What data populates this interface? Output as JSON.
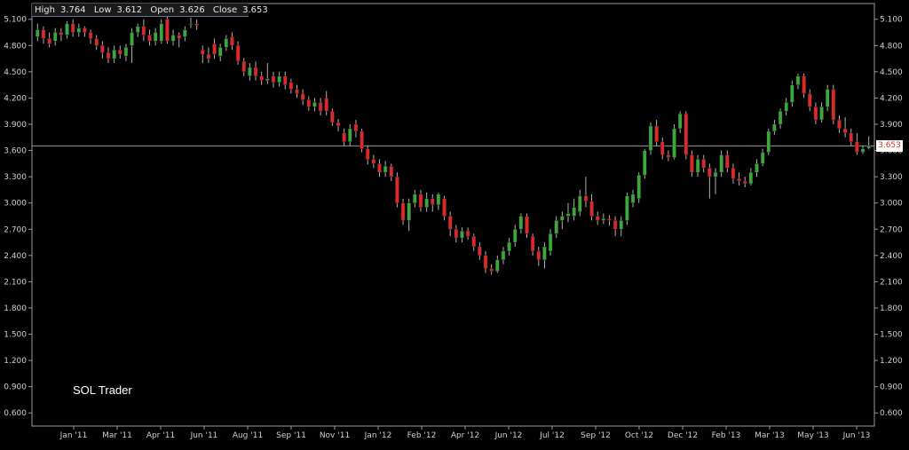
{
  "ohlc": {
    "high_label": "High",
    "high": "3.764",
    "low_label": "Low",
    "low": "3.612",
    "open_label": "Open",
    "open": "3.626",
    "close_label": "Close",
    "close": "3.653"
  },
  "watermark": "SOL Trader",
  "last_price_label": "3.653",
  "colors": {
    "up": "#3aa83a",
    "down": "#e02828",
    "wick": "#b0b0b0",
    "axis": "#9a9a9a",
    "background": "#000000",
    "last_line": "#9a9a9a"
  },
  "chart_data": {
    "type": "candlestick",
    "ylim": [
      0.45,
      5.28
    ],
    "y_ticks": [
      "5.100",
      "4.800",
      "4.500",
      "4.200",
      "3.900",
      "3.600",
      "3.300",
      "3.000",
      "2.700",
      "2.400",
      "2.100",
      "1.800",
      "1.500",
      "1.200",
      "0.900",
      "0.600"
    ],
    "x_ticks": [
      "Jan '11",
      "Mar '11",
      "Apr '11",
      "Jun '11",
      "Aug '11",
      "Sep '11",
      "Nov '11",
      "Jan '12",
      "Feb '12",
      "Apr '12",
      "Jun '12",
      "Jul '12",
      "Sep '12",
      "Oct '12",
      "Dec '12",
      "Feb '13",
      "Mar '13",
      "May '13",
      "Jun '13"
    ],
    "last_price": 3.653,
    "candles": [
      [
        4.9,
        4.98,
        5.05,
        4.85
      ],
      [
        4.98,
        4.88,
        5.02,
        4.82
      ],
      [
        4.88,
        4.82,
        4.95,
        4.78
      ],
      [
        4.85,
        4.95,
        5.0,
        4.8
      ],
      [
        4.95,
        4.92,
        5.0,
        4.85
      ],
      [
        4.92,
        5.05,
        5.08,
        4.88
      ],
      [
        5.05,
        4.95,
        5.1,
        4.9
      ],
      [
        4.95,
        5.0,
        5.05,
        4.9
      ],
      [
        5.0,
        4.95,
        5.02,
        4.9
      ],
      [
        4.95,
        4.88,
        4.98,
        4.82
      ],
      [
        4.88,
        4.8,
        4.92,
        4.75
      ],
      [
        4.8,
        4.72,
        4.85,
        4.65
      ],
      [
        4.72,
        4.65,
        4.78,
        4.6
      ],
      [
        4.65,
        4.75,
        4.8,
        4.6
      ],
      [
        4.75,
        4.7,
        4.8,
        4.65
      ],
      [
        4.68,
        4.78,
        4.82,
        4.62
      ],
      [
        4.8,
        4.95,
        5.0,
        4.6
      ],
      [
        4.95,
        5.02,
        5.05,
        4.9
      ],
      [
        5.02,
        4.92,
        5.1,
        4.85
      ],
      [
        4.92,
        4.85,
        4.98,
        4.8
      ],
      [
        4.85,
        4.95,
        5.0,
        4.8
      ],
      [
        4.85,
        5.05,
        5.1,
        4.82
      ],
      [
        5.1,
        4.85,
        5.15,
        4.82
      ],
      [
        4.85,
        4.92,
        4.98,
        4.8
      ],
      [
        4.92,
        4.88,
        4.95,
        4.78
      ],
      [
        4.9,
        4.98,
        5.02,
        4.85
      ],
      [
        5.05,
        5.05,
        5.12,
        5.0
      ],
      [
        5.05,
        5.03,
        5.1,
        4.98
      ],
      [
        4.75,
        4.7,
        4.8,
        4.6
      ],
      [
        4.7,
        4.65,
        4.78,
        4.6
      ],
      [
        4.82,
        4.7,
        4.88,
        4.65
      ],
      [
        4.68,
        4.78,
        4.82,
        4.62
      ],
      [
        4.78,
        4.88,
        4.92,
        4.74
      ],
      [
        4.9,
        4.8,
        4.95,
        4.75
      ],
      [
        4.8,
        4.62,
        4.85,
        4.58
      ],
      [
        4.62,
        4.5,
        4.66,
        4.45
      ],
      [
        4.45,
        4.55,
        4.6,
        4.4
      ],
      [
        4.55,
        4.45,
        4.62,
        4.4
      ],
      [
        4.45,
        4.4,
        4.5,
        4.35
      ],
      [
        4.4,
        4.42,
        4.6,
        4.36
      ],
      [
        4.45,
        4.38,
        4.5,
        4.32
      ],
      [
        4.38,
        4.45,
        4.5,
        4.33
      ],
      [
        4.45,
        4.35,
        4.5,
        4.3
      ],
      [
        4.38,
        4.3,
        4.42,
        4.25
      ],
      [
        4.3,
        4.25,
        4.35,
        4.2
      ],
      [
        4.25,
        4.18,
        4.3,
        4.12
      ],
      [
        4.18,
        4.1,
        4.22,
        4.05
      ],
      [
        4.1,
        4.15,
        4.2,
        4.05
      ],
      [
        4.15,
        4.05,
        4.2,
        4.0
      ],
      [
        4.2,
        4.05,
        4.28,
        4.0
      ],
      [
        4.05,
        3.92,
        4.08,
        3.88
      ],
      [
        3.92,
        3.88,
        3.96,
        3.82
      ],
      [
        3.8,
        3.7,
        3.85,
        3.65
      ],
      [
        3.7,
        3.85,
        3.9,
        3.65
      ],
      [
        3.9,
        3.82,
        3.95,
        3.75
      ],
      [
        3.82,
        3.62,
        3.85,
        3.58
      ],
      [
        3.62,
        3.5,
        3.66,
        3.44
      ],
      [
        3.5,
        3.45,
        3.55,
        3.4
      ],
      [
        3.45,
        3.35,
        3.5,
        3.3
      ],
      [
        3.35,
        3.42,
        3.48,
        3.3
      ],
      [
        3.42,
        3.3,
        3.45,
        3.25
      ],
      [
        3.3,
        3.0,
        3.35,
        2.95
      ],
      [
        3.0,
        2.8,
        3.05,
        2.75
      ],
      [
        2.8,
        3.0,
        3.05,
        2.68
      ],
      [
        3.0,
        3.1,
        3.15,
        2.95
      ],
      [
        3.1,
        2.95,
        3.15,
        2.9
      ],
      [
        2.95,
        3.05,
        3.12,
        2.9
      ],
      [
        3.05,
        2.98,
        3.1,
        2.9
      ],
      [
        2.98,
        3.1,
        3.12,
        2.92
      ],
      [
        3.05,
        2.85,
        3.08,
        2.8
      ],
      [
        2.85,
        2.7,
        2.9,
        2.62
      ],
      [
        2.7,
        2.6,
        2.75,
        2.55
      ],
      [
        2.6,
        2.68,
        2.72,
        2.55
      ],
      [
        2.68,
        2.62,
        2.72,
        2.58
      ],
      [
        2.62,
        2.5,
        2.65,
        2.45
      ],
      [
        2.5,
        2.4,
        2.55,
        2.35
      ],
      [
        2.4,
        2.25,
        2.45,
        2.2
      ],
      [
        2.25,
        2.22,
        2.3,
        2.18
      ],
      [
        2.22,
        2.35,
        2.4,
        2.2
      ],
      [
        2.35,
        2.45,
        2.5,
        2.3
      ],
      [
        2.45,
        2.55,
        2.6,
        2.4
      ],
      [
        2.55,
        2.7,
        2.75,
        2.5
      ],
      [
        2.7,
        2.85,
        2.88,
        2.65
      ],
      [
        2.85,
        2.65,
        2.88,
        2.6
      ],
      [
        2.62,
        2.45,
        2.65,
        2.4
      ],
      [
        2.45,
        2.35,
        2.5,
        2.28
      ],
      [
        2.35,
        2.5,
        2.55,
        2.25
      ],
      [
        2.45,
        2.65,
        2.7,
        2.4
      ],
      [
        2.65,
        2.8,
        2.85,
        2.6
      ],
      [
        2.8,
        2.85,
        2.9,
        2.7
      ],
      [
        2.85,
        2.88,
        3.0,
        2.78
      ],
      [
        2.85,
        2.95,
        3.05,
        2.8
      ],
      [
        2.9,
        3.08,
        3.15,
        2.85
      ],
      [
        3.08,
        3.02,
        3.3,
        2.95
      ],
      [
        3.02,
        2.85,
        3.1,
        2.8
      ],
      [
        2.85,
        2.8,
        2.9,
        2.75
      ],
      [
        2.8,
        2.82,
        2.88,
        2.76
      ],
      [
        2.82,
        2.8,
        2.86,
        2.74
      ],
      [
        2.8,
        2.7,
        2.85,
        2.62
      ],
      [
        2.7,
        2.8,
        2.85,
        2.62
      ],
      [
        2.8,
        3.08,
        3.12,
        2.75
      ],
      [
        3.0,
        3.1,
        3.15,
        2.95
      ],
      [
        3.05,
        3.32,
        3.35,
        3.0
      ],
      [
        3.32,
        3.6,
        3.62,
        3.28
      ],
      [
        3.6,
        3.88,
        3.92,
        3.55
      ],
      [
        3.88,
        3.7,
        3.95,
        3.65
      ],
      [
        3.7,
        3.55,
        3.75,
        3.5
      ],
      [
        3.55,
        3.52,
        3.6,
        3.48
      ],
      [
        3.52,
        3.85,
        3.9,
        3.5
      ],
      [
        3.85,
        4.02,
        4.05,
        3.8
      ],
      [
        4.02,
        3.55,
        4.05,
        3.5
      ],
      [
        3.55,
        3.35,
        3.6,
        3.3
      ],
      [
        3.35,
        3.5,
        3.55,
        3.3
      ],
      [
        3.5,
        3.4,
        3.55,
        3.35
      ],
      [
        3.4,
        3.3,
        3.45,
        3.05
      ],
      [
        3.3,
        3.35,
        3.4,
        3.1
      ],
      [
        3.35,
        3.55,
        3.6,
        3.3
      ],
      [
        3.55,
        3.4,
        3.6,
        3.35
      ],
      [
        3.4,
        3.28,
        3.45,
        3.22
      ],
      [
        3.28,
        3.25,
        3.35,
        3.2
      ],
      [
        3.25,
        3.22,
        3.3,
        3.18
      ],
      [
        3.22,
        3.35,
        3.4,
        3.2
      ],
      [
        3.35,
        3.45,
        3.5,
        3.3
      ],
      [
        3.45,
        3.58,
        3.62,
        3.42
      ],
      [
        3.58,
        3.82,
        3.85,
        3.55
      ],
      [
        3.82,
        3.9,
        3.95,
        3.78
      ],
      [
        3.9,
        4.05,
        4.08,
        3.85
      ],
      [
        4.05,
        4.15,
        4.2,
        4.0
      ],
      [
        4.15,
        4.35,
        4.4,
        4.1
      ],
      [
        4.35,
        4.45,
        4.48,
        4.3
      ],
      [
        4.45,
        4.25,
        4.48,
        4.2
      ],
      [
        4.25,
        4.1,
        4.3,
        4.05
      ],
      [
        4.1,
        3.95,
        4.15,
        3.9
      ],
      [
        3.95,
        4.1,
        4.15,
        3.92
      ],
      [
        4.1,
        4.3,
        4.35,
        4.05
      ],
      [
        4.3,
        3.95,
        4.35,
        3.9
      ],
      [
        3.95,
        3.85,
        4.0,
        3.8
      ],
      [
        3.85,
        3.8,
        3.98,
        3.75
      ],
      [
        3.8,
        3.7,
        3.85,
        3.65
      ],
      [
        3.7,
        3.58,
        3.8,
        3.55
      ],
      [
        3.58,
        3.62,
        3.66,
        3.56
      ],
      [
        3.626,
        3.653,
        3.764,
        3.612
      ]
    ]
  }
}
